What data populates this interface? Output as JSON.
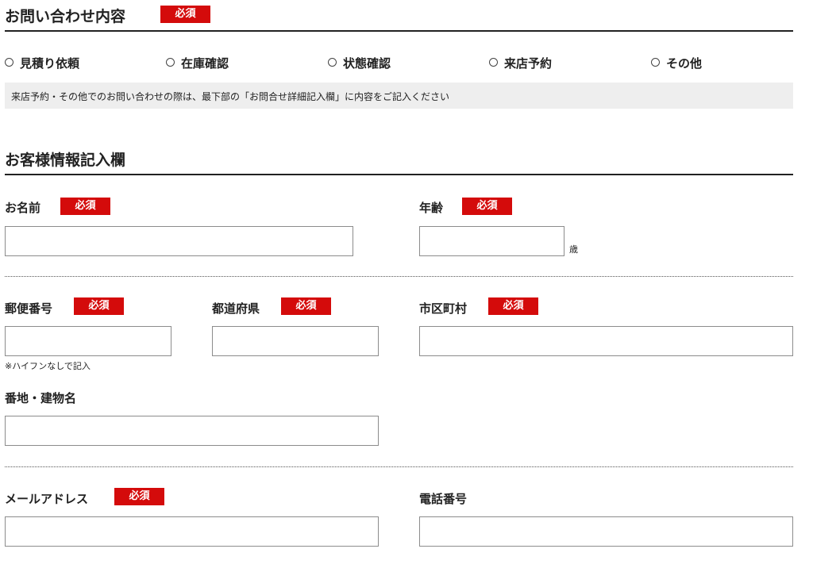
{
  "inquiry": {
    "title": "お問い合わせ内容",
    "required_badge": "必須",
    "options": [
      "見積り依頼",
      "在庫確認",
      "状態確認",
      "来店予約",
      "その他"
    ],
    "note": "来店予約・その他でのお問い合わせの際は、最下部の「お問合せ詳細記入欄」に内容をご記入ください"
  },
  "customer": {
    "title": "お客様情報記入欄",
    "required_badge": "必須",
    "name_label": "お名前",
    "age_label": "年齢",
    "age_unit": "歳",
    "postal_label": "郵便番号",
    "postal_hint": "※ハイフンなしで記入",
    "prefecture_label": "都道府県",
    "city_label": "市区町村",
    "address_label": "番地・建物名",
    "email_label": "メールアドレス",
    "phone_label": "電話番号"
  }
}
